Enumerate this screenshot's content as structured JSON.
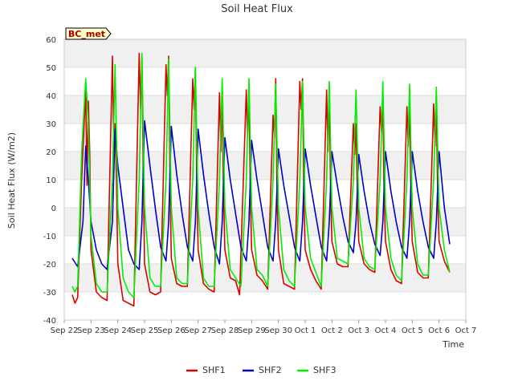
{
  "chart_data": {
    "type": "line",
    "title": "Soil Heat Flux",
    "xlabel": "Time",
    "ylabel": "Soil Heat Flux (W/m2)",
    "badge": "BC_met",
    "xlim": [
      0,
      15
    ],
    "ylim": [
      -40,
      60
    ],
    "yticks": [
      -40,
      -30,
      -20,
      -10,
      0,
      10,
      20,
      30,
      40,
      50,
      60
    ],
    "xticks": [
      {
        "pos": 0,
        "label": "Sep 22"
      },
      {
        "pos": 1,
        "label": "Sep 23"
      },
      {
        "pos": 2,
        "label": "Sep 24"
      },
      {
        "pos": 3,
        "label": "Sep 25"
      },
      {
        "pos": 4,
        "label": "Sep 26"
      },
      {
        "pos": 5,
        "label": "Sep 27"
      },
      {
        "pos": 6,
        "label": "Sep 28"
      },
      {
        "pos": 7,
        "label": "Sep 29"
      },
      {
        "pos": 8,
        "label": "Sep 30"
      },
      {
        "pos": 9,
        "label": "Oct 1"
      },
      {
        "pos": 10,
        "label": "Oct 2"
      },
      {
        "pos": 11,
        "label": "Oct 3"
      },
      {
        "pos": 12,
        "label": "Oct 4"
      },
      {
        "pos": 13,
        "label": "Oct 5"
      },
      {
        "pos": 14,
        "label": "Oct 6"
      },
      {
        "pos": 15,
        "label": "Oct 7"
      }
    ],
    "grid": true,
    "legend_position": "bottom",
    "series": [
      {
        "name": "SHF1",
        "color": "#dd0000",
        "x": [
          0.3,
          0.4,
          0.5,
          0.65,
          0.8,
          0.85,
          0.9,
          0.95,
          1.0,
          1.2,
          1.4,
          1.6,
          1.8,
          1.85,
          1.9,
          1.95,
          2.0,
          2.2,
          2.4,
          2.6,
          2.8,
          2.85,
          2.9,
          2.95,
          3.0,
          3.2,
          3.4,
          3.6,
          3.8,
          3.85,
          3.9,
          3.95,
          4.0,
          4.2,
          4.4,
          4.6,
          4.8,
          4.85,
          4.9,
          4.95,
          5.0,
          5.2,
          5.4,
          5.6,
          5.8,
          5.85,
          5.9,
          5.95,
          6.0,
          6.2,
          6.4,
          6.55,
          6.8,
          6.85,
          6.9,
          6.95,
          7.0,
          7.2,
          7.4,
          7.6,
          7.8,
          7.85,
          7.9,
          7.95,
          8.0,
          8.2,
          8.4,
          8.6,
          8.8,
          8.85,
          8.9,
          8.95,
          9.0,
          9.2,
          9.4,
          9.6,
          9.8,
          9.85,
          9.9,
          9.95,
          10.0,
          10.2,
          10.4,
          10.6,
          10.8,
          10.85,
          10.9,
          10.95,
          11.0,
          11.2,
          11.4,
          11.6,
          11.8,
          11.85,
          11.9,
          11.95,
          12.0,
          12.2,
          12.4,
          12.6,
          12.8,
          12.85,
          12.9,
          12.95,
          13.0,
          13.2,
          13.4,
          13.6,
          13.8,
          13.85,
          13.9,
          13.95,
          14.0
        ],
        "y": [
          -31,
          -34,
          -32,
          10,
          42,
          8,
          38,
          20,
          -15,
          -30,
          -32,
          -33,
          54,
          20,
          30,
          10,
          -20,
          -33,
          -34,
          -35,
          55,
          35,
          54,
          15,
          -20,
          -30,
          -31,
          -30,
          51,
          40,
          54,
          10,
          -18,
          -27,
          -28,
          -28,
          46,
          35,
          50,
          10,
          -15,
          -27,
          -29,
          -30,
          41,
          20,
          41,
          5,
          -15,
          -25,
          -26,
          -31,
          42,
          25,
          42,
          5,
          -15,
          -24,
          -26,
          -29,
          33,
          25,
          46,
          5,
          -15,
          -27,
          -28,
          -29,
          45,
          35,
          46,
          5,
          -15,
          -22,
          -26,
          -29,
          42,
          20,
          42,
          5,
          -12,
          -20,
          -21,
          -21,
          30,
          19,
          30,
          5,
          -12,
          -20,
          -22,
          -23,
          36,
          27,
          36,
          5,
          -12,
          -22,
          -26,
          -27,
          36,
          22,
          36,
          5,
          -12,
          -23,
          -25,
          -25,
          37,
          22,
          37,
          5,
          -12
        ],
        "tail": {
          "x": [
            14.2,
            14.4
          ],
          "y": [
            -19,
            -23
          ]
        }
      },
      {
        "name": "SHF2",
        "color": "#0000cc",
        "x": [
          0.3,
          0.5,
          0.7,
          0.8,
          0.9,
          1.0,
          1.2,
          1.4,
          1.6,
          1.8,
          1.9,
          2.0,
          2.2,
          2.4,
          2.6,
          2.8,
          2.9,
          3.0,
          3.2,
          3.4,
          3.6,
          3.8,
          3.9,
          4.0,
          4.2,
          4.4,
          4.6,
          4.8,
          4.9,
          5.0,
          5.2,
          5.4,
          5.6,
          5.8,
          5.9,
          6.0,
          6.2,
          6.4,
          6.6,
          6.8,
          6.9,
          7.0,
          7.2,
          7.4,
          7.6,
          7.8,
          7.9,
          8.0,
          8.2,
          8.4,
          8.6,
          8.8,
          8.9,
          9.0,
          9.2,
          9.4,
          9.6,
          9.8,
          9.9,
          10.0,
          10.2,
          10.4,
          10.6,
          10.8,
          10.9,
          11.0,
          11.2,
          11.4,
          11.6,
          11.8,
          11.9,
          12.0,
          12.2,
          12.4,
          12.6,
          12.8,
          12.9,
          13.0,
          13.2,
          13.4,
          13.6,
          13.8,
          13.9,
          14.0,
          14.2,
          14.4
        ],
        "y": [
          -18,
          -21,
          -5,
          22,
          10,
          -5,
          -15,
          -20,
          -22,
          -5,
          28,
          15,
          0,
          -15,
          -20,
          -22,
          -5,
          31,
          15,
          0,
          -14,
          -19,
          -5,
          29,
          12,
          -2,
          -14,
          -19,
          -5,
          28,
          12,
          -2,
          -14,
          -20,
          -5,
          25,
          10,
          -2,
          -14,
          -19,
          -5,
          24,
          10,
          -2,
          -14,
          -19,
          -5,
          21,
          8,
          -3,
          -14,
          -19,
          -5,
          21,
          8,
          -3,
          -14,
          -19,
          -5,
          20,
          8,
          -3,
          -12,
          -16,
          -5,
          19,
          6,
          -5,
          -13,
          -17,
          -5,
          20,
          6,
          -5,
          -14,
          -18,
          -5,
          20,
          6,
          -5,
          -14,
          -18,
          -5,
          20,
          0,
          -13
        ]
      },
      {
        "name": "SHF3",
        "color": "#00ee00",
        "x": [
          0.3,
          0.4,
          0.5,
          0.65,
          0.8,
          0.9,
          1.0,
          1.2,
          1.4,
          1.6,
          1.8,
          1.9,
          2.0,
          2.2,
          2.4,
          2.6,
          2.8,
          2.9,
          3.0,
          3.2,
          3.4,
          3.6,
          3.8,
          3.9,
          4.0,
          4.2,
          4.4,
          4.6,
          4.8,
          4.9,
          5.0,
          5.2,
          5.4,
          5.6,
          5.8,
          5.9,
          6.0,
          6.2,
          6.4,
          6.6,
          6.8,
          6.9,
          7.0,
          7.2,
          7.4,
          7.6,
          7.8,
          7.9,
          8.0,
          8.2,
          8.4,
          8.6,
          8.8,
          8.9,
          9.0,
          9.2,
          9.4,
          9.6,
          9.8,
          9.9,
          10.0,
          10.2,
          10.4,
          10.6,
          10.8,
          10.9,
          11.0,
          11.2,
          11.4,
          11.6,
          11.8,
          11.9,
          12.0,
          12.2,
          12.4,
          12.6,
          12.8,
          12.9,
          13.0,
          13.2,
          13.4,
          13.6,
          13.8,
          13.9,
          14.0
        ],
        "y": [
          -28,
          -30,
          -28,
          20,
          46,
          30,
          -10,
          -27,
          -30,
          -30,
          10,
          51,
          0,
          -25,
          -30,
          -32,
          10,
          55,
          0,
          -25,
          -28,
          -28,
          10,
          53,
          0,
          -25,
          -27,
          -27,
          10,
          50,
          0,
          -25,
          -28,
          -28,
          10,
          46,
          0,
          -22,
          -25,
          -28,
          10,
          46,
          0,
          -22,
          -24,
          -28,
          10,
          44,
          0,
          -22,
          -26,
          -28,
          10,
          45,
          0,
          -18,
          -23,
          -28,
          10,
          45,
          0,
          -18,
          -19,
          -20,
          10,
          42,
          0,
          -18,
          -21,
          -22,
          10,
          45,
          0,
          -18,
          -24,
          -26,
          10,
          44,
          0,
          -20,
          -24,
          -24,
          10,
          43,
          0
        ],
        "tail": {
          "x": [
            14.2,
            14.4
          ],
          "y": [
            -15,
            -23
          ]
        }
      }
    ]
  }
}
